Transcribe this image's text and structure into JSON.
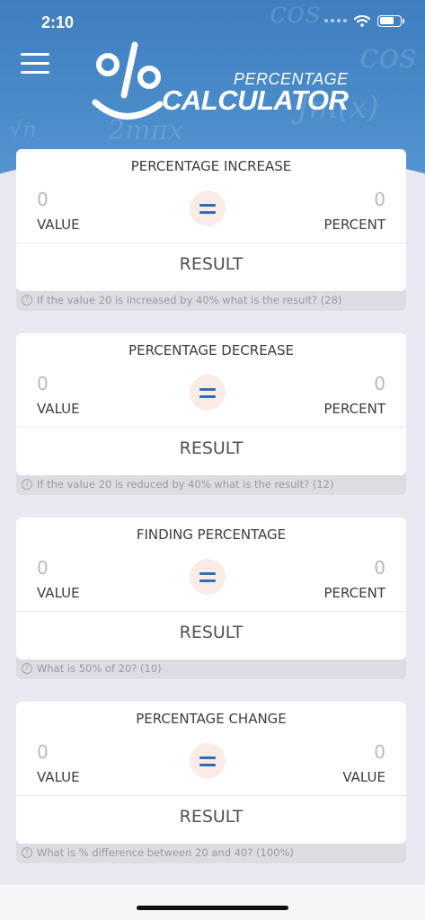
{
  "status": {
    "time": "2:10"
  },
  "app": {
    "logo_top": "PERCENTAGE",
    "logo_main": "CALCULATOR"
  },
  "icons": {
    "menu": "hamburger-menu-icon",
    "wifi": "wifi-icon",
    "battery": "battery-icon",
    "help": "question-circle-icon",
    "equals": "equals-icon"
  },
  "colors": {
    "header_blue": "#4b8ccb",
    "accent_blue": "#2f6db5",
    "equals_bg": "#fcece8",
    "page_bg": "#e9e9f1"
  },
  "calculators": [
    {
      "title": "PERCENTAGE INCREASE",
      "left_value": "0",
      "left_label": "VALUE",
      "right_value": "0",
      "right_label": "PERCENT",
      "result_label": "RESULT",
      "hint": "If the value 20 is increased by 40% what is the result? (28)"
    },
    {
      "title": "PERCENTAGE DECREASE",
      "left_value": "0",
      "left_label": "VALUE",
      "right_value": "0",
      "right_label": "PERCENT",
      "result_label": "RESULT",
      "hint": "If the value 20 is reduced by 40% what is the result? (12)"
    },
    {
      "title": "FINDING PERCENTAGE",
      "left_value": "0",
      "left_label": "VALUE",
      "right_value": "0",
      "right_label": "PERCENT",
      "result_label": "RESULT",
      "hint": "What is 50% of 20? (10)"
    },
    {
      "title": "PERCENTAGE CHANGE",
      "left_value": "0",
      "left_label": "VALUE",
      "right_value": "0",
      "right_label": "VALUE",
      "result_label": "RESULT",
      "hint": "What is % difference between 20 and 40? (100%)"
    }
  ]
}
